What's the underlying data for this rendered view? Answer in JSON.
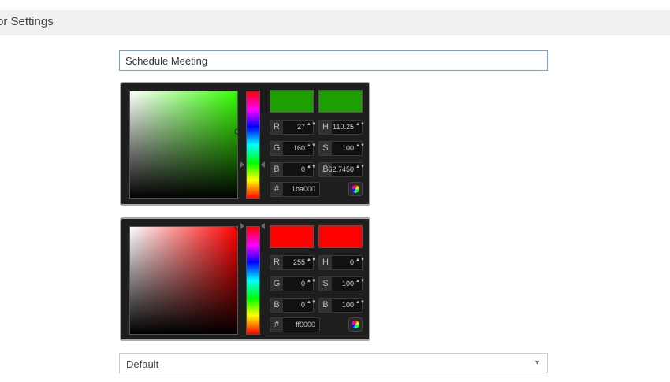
{
  "header": {
    "title": "or Settings"
  },
  "title_input": {
    "value": "Schedule Meeting"
  },
  "pickers": [
    {
      "hue": 110.25,
      "saturation": 1.0,
      "brightness": 0.627,
      "hue_position": 0.69,
      "new_color": "#1ba000",
      "current_color": "#1ba000",
      "hue_color": "#33ff00",
      "fields": {
        "r": {
          "label": "R",
          "value": "27"
        },
        "g": {
          "label": "G",
          "value": "160"
        },
        "b": {
          "label": "B",
          "value": "0"
        },
        "h": {
          "label": "H",
          "value": "110.25"
        },
        "s": {
          "label": "S",
          "value": "100"
        },
        "bv": {
          "label": "B",
          "value": "62.7450"
        },
        "hex": {
          "label": "#",
          "value": "1ba000"
        }
      },
      "spin_glyph": "▲▼",
      "wheel_icon": "color-wheel-icon"
    },
    {
      "hue": 0,
      "saturation": 1.0,
      "brightness": 1.0,
      "hue_position": 0.0,
      "new_color": "#ff0000",
      "current_color": "#ff0000",
      "hue_color": "#ff0000",
      "fields": {
        "r": {
          "label": "R",
          "value": "255"
        },
        "g": {
          "label": "G",
          "value": "0"
        },
        "b": {
          "label": "B",
          "value": "0"
        },
        "h": {
          "label": "H",
          "value": "0"
        },
        "s": {
          "label": "S",
          "value": "100"
        },
        "bv": {
          "label": "B",
          "value": "100"
        },
        "hex": {
          "label": "#",
          "value": "ff0000"
        }
      },
      "spin_glyph": "▲▼",
      "wheel_icon": "color-wheel-icon"
    }
  ],
  "select": {
    "value": "Default",
    "caret": "▼"
  }
}
